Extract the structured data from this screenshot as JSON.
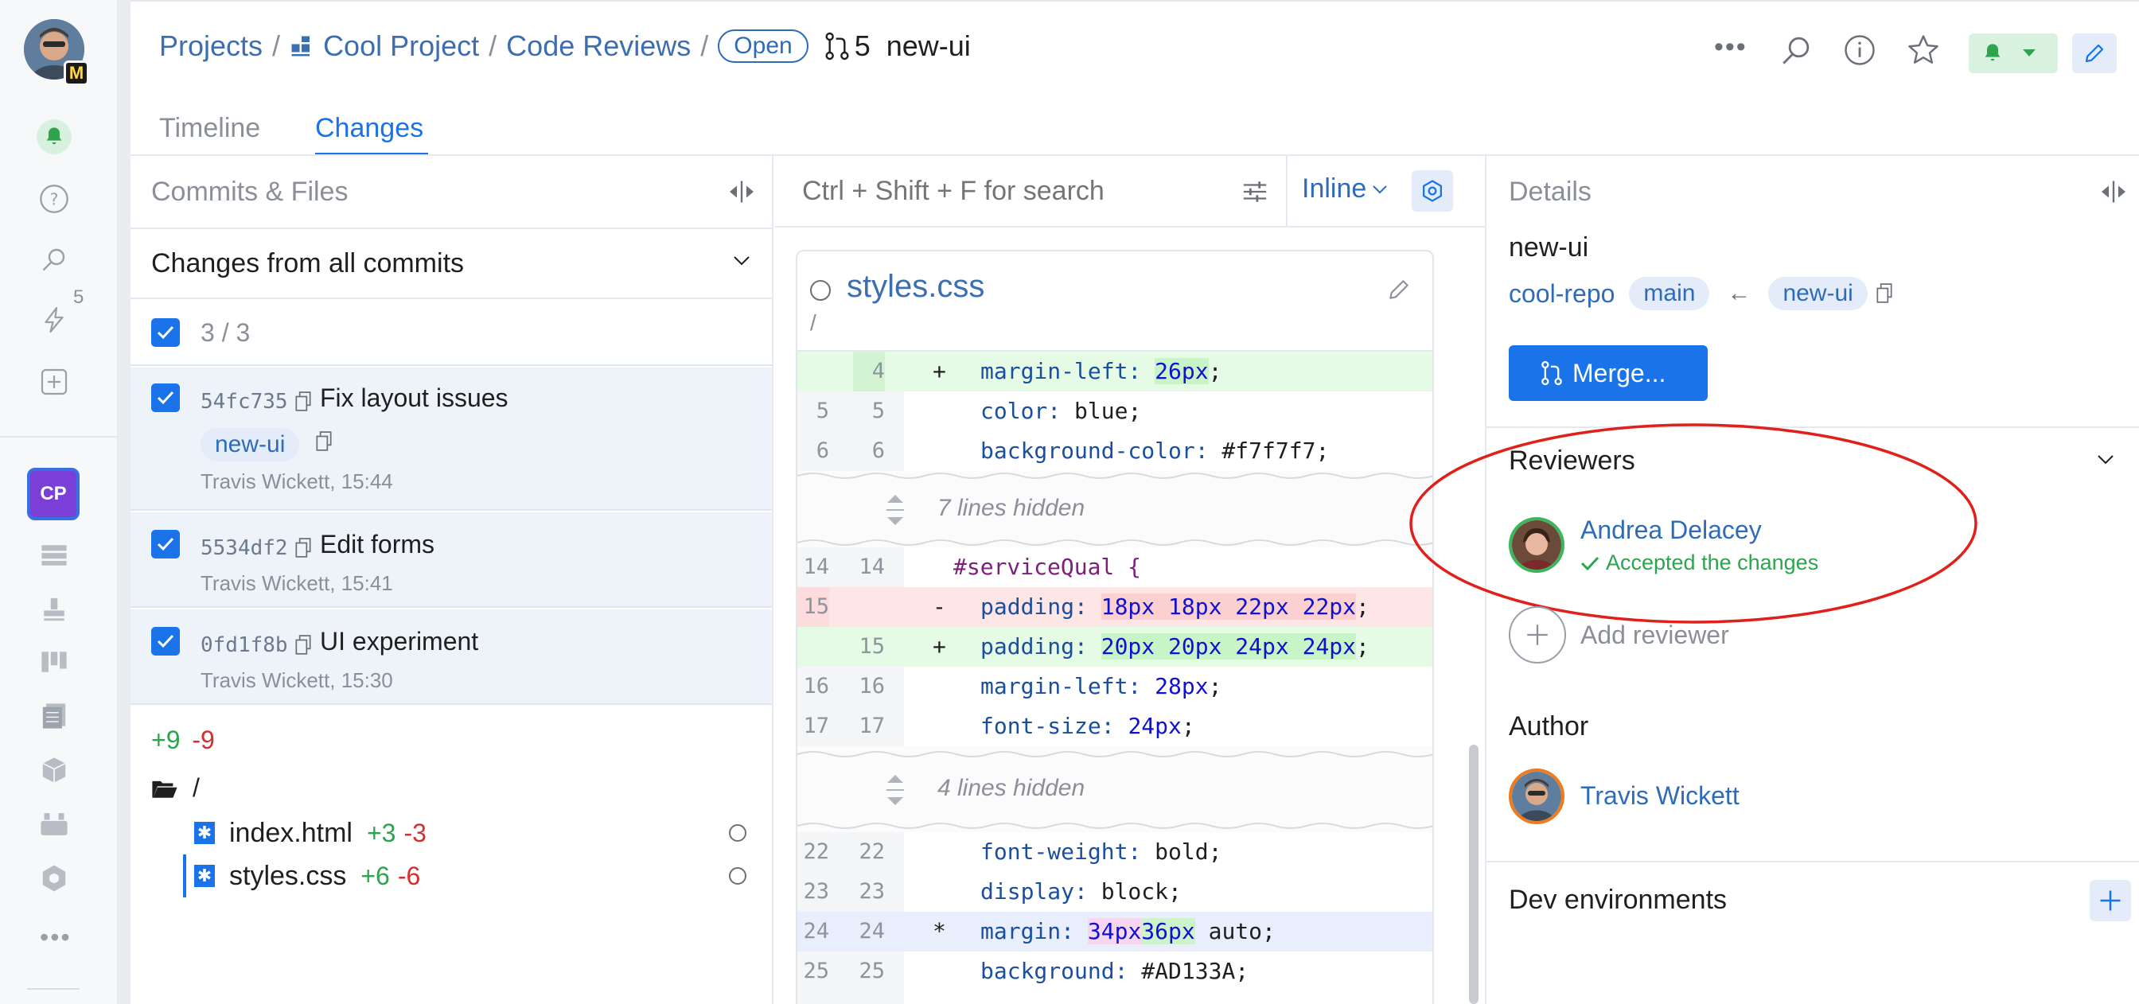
{
  "rail": {
    "avatar_badge": "M",
    "notif_count": "5",
    "project_badge": "CP"
  },
  "header": {
    "crumbs": [
      "Projects",
      "Cool Project",
      "Code Reviews"
    ],
    "sep": "/",
    "status": "Open",
    "review_number": "5",
    "branch": "new-ui",
    "tabs": [
      "Timeline",
      "Changes"
    ],
    "active_tab": "Changes"
  },
  "commits_pane": {
    "title": "Commits & Files",
    "filter": "Changes from all commits",
    "count": "3 / 3",
    "commits": [
      {
        "hash": "54fc735",
        "message": "Fix layout issues",
        "branch": "new-ui",
        "meta": "Travis Wickett, 15:44"
      },
      {
        "hash": "5534df2",
        "message": "Edit forms",
        "meta": "Travis Wickett, 15:41"
      },
      {
        "hash": "0fd1f8b",
        "message": "UI experiment",
        "meta": "Travis Wickett, 15:30"
      }
    ],
    "total_added": "+9",
    "total_removed": "-9",
    "folder": "/",
    "files": [
      {
        "name": "index.html",
        "added": "+3",
        "removed": "-3"
      },
      {
        "name": "styles.css",
        "added": "+6",
        "removed": "-6"
      }
    ]
  },
  "diff": {
    "search_placeholder": "Ctrl + Shift + F for search",
    "view_mode": "Inline",
    "file_name": "styles.css",
    "file_path": "/",
    "hidden1": "7 lines hidden",
    "hidden2": "4 lines hidden",
    "lines": [
      {
        "old": "",
        "new": "4",
        "mark": "+",
        "prop": "margin-left:",
        "val": "26px",
        "rest": ";",
        "kind": "add"
      },
      {
        "old": "5",
        "new": "5",
        "mark": "",
        "prop": "color:",
        "val": "",
        "rest": " blue;",
        "kind": "ctx"
      },
      {
        "old": "6",
        "new": "6",
        "mark": "",
        "prop": "background-color:",
        "val": "",
        "rest": " #f7f7f7;",
        "kind": "ctx"
      },
      {
        "old": "14",
        "new": "14",
        "mark": "",
        "prop": "",
        "val": "",
        "rest": "#serviceQual {",
        "kind": "sel"
      },
      {
        "old": "15",
        "new": "",
        "mark": "-",
        "prop": "padding:",
        "val": "18px 18px 22px 22px",
        "rest": ";",
        "kind": "del"
      },
      {
        "old": "",
        "new": "15",
        "mark": "+",
        "prop": "padding:",
        "val": "20px 20px 24px 24px",
        "rest": ";",
        "kind": "add"
      },
      {
        "old": "16",
        "new": "16",
        "mark": "",
        "prop": "margin-left:",
        "val": "28px",
        "rest": ";",
        "kind": "ctx"
      },
      {
        "old": "17",
        "new": "17",
        "mark": "",
        "prop": "font-size:",
        "val": "24px",
        "rest": ";",
        "kind": "ctx"
      },
      {
        "old": "22",
        "new": "22",
        "mark": "",
        "prop": "font-weight:",
        "val": "",
        "rest": " bold;",
        "kind": "ctx"
      },
      {
        "old": "23",
        "new": "23",
        "mark": "",
        "prop": "display:",
        "val": "",
        "rest": " block;",
        "kind": "ctx"
      },
      {
        "old": "24",
        "new": "24",
        "mark": "*",
        "prop": "margin:",
        "val": "34px36px",
        "rest": " auto;",
        "kind": "mod"
      },
      {
        "old": "25",
        "new": "25",
        "mark": "",
        "prop": "background:",
        "val": "",
        "rest": " #AD133A;",
        "kind": "ctx"
      }
    ]
  },
  "details": {
    "title": "Details",
    "branch": "new-ui",
    "repo": "cool-repo",
    "target": "main",
    "source": "new-ui",
    "arrow": "←",
    "merge_label": "Merge...",
    "reviewers_title": "Reviewers",
    "reviewer_name": "Andrea Delacey",
    "reviewer_status": "Accepted the changes",
    "add_reviewer": "Add reviewer",
    "author_title": "Author",
    "author_name": "Travis Wickett",
    "dev_env_title": "Dev environments"
  },
  "colors": {
    "accent": "#1a73e8",
    "added": "#2da44e",
    "removed": "#d32f2f",
    "annotation": "#e0201a"
  }
}
